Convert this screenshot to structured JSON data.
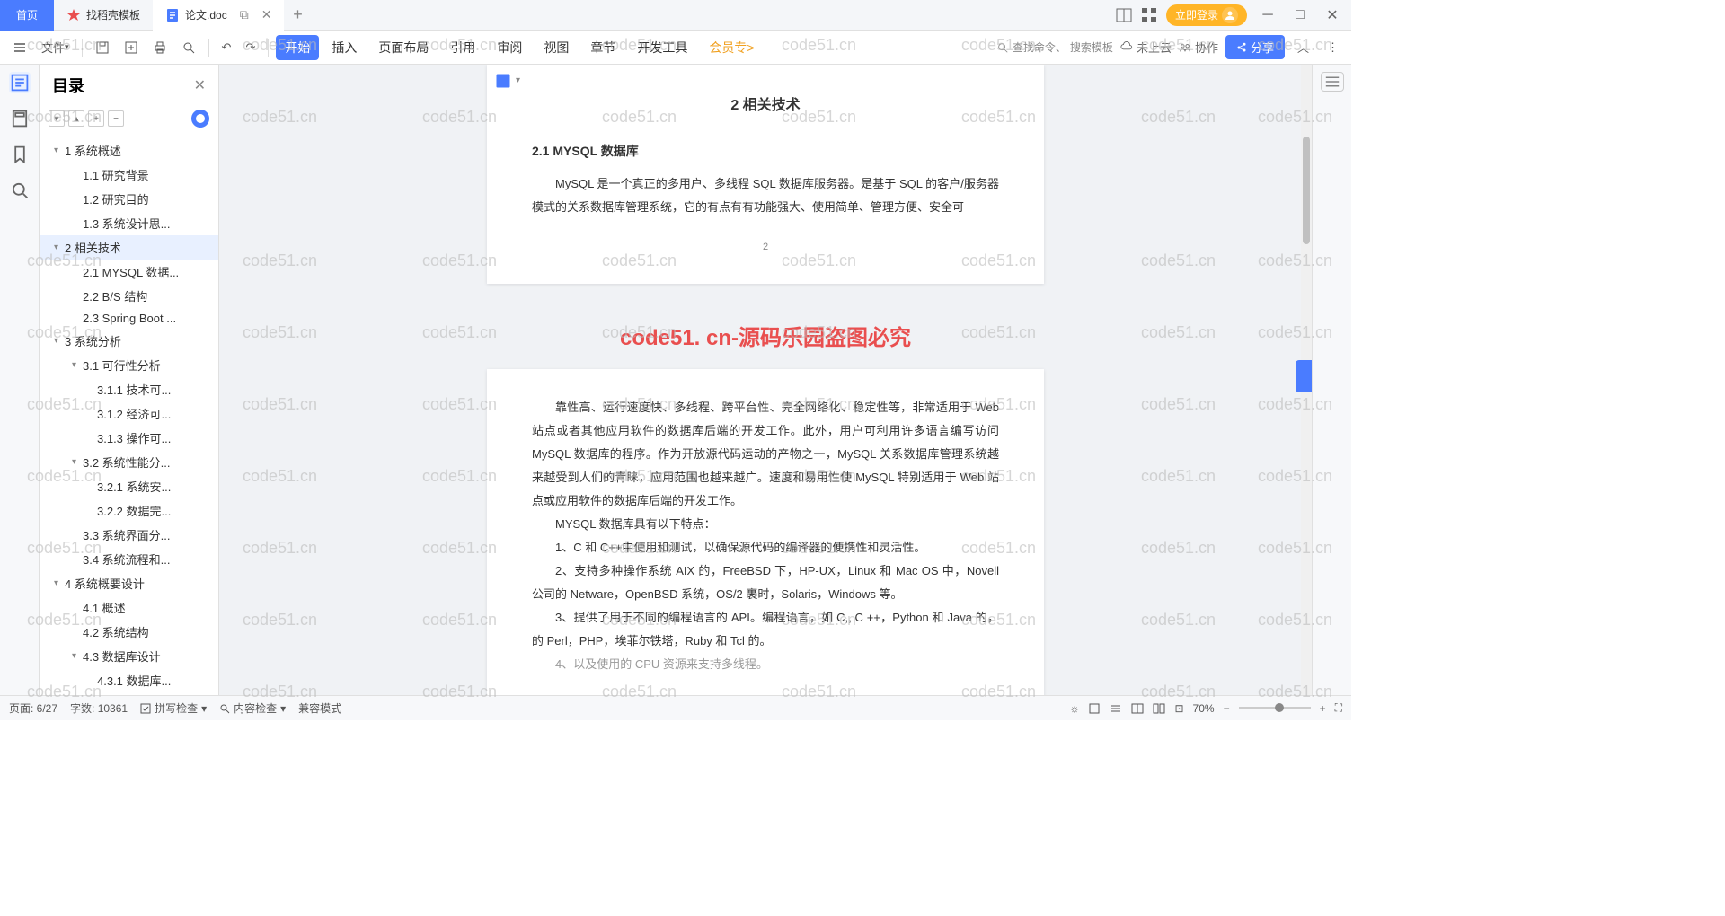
{
  "titlebar": {
    "home": "首页",
    "template": "找稻壳模板",
    "doc": "论文.doc",
    "login": "立即登录"
  },
  "toolbar": {
    "file": "文件"
  },
  "menu": {
    "start": "开始",
    "insert": "插入",
    "layout": "页面布局",
    "reference": "引用",
    "review": "审阅",
    "view": "视图",
    "chapter": "章节",
    "devtools": "开发工具",
    "vip": "会员专"
  },
  "search": {
    "cmd": "查找命令、",
    "tpl": "搜索模板"
  },
  "cloud": {
    "status": "未上云",
    "collab": "协作",
    "share": "分享"
  },
  "outline": {
    "title": "目录",
    "items": [
      {
        "level": 1,
        "text": "1 系统概述",
        "chev": "▾"
      },
      {
        "level": 2,
        "text": "1.1 研究背景"
      },
      {
        "level": 2,
        "text": "1.2 研究目的"
      },
      {
        "level": 2,
        "text": "1.3 系统设计思..."
      },
      {
        "level": 1,
        "text": "2 相关技术",
        "chev": "▾",
        "active": true
      },
      {
        "level": 2,
        "text": "2.1 MYSQL 数据..."
      },
      {
        "level": 2,
        "text": "2.2 B/S 结构"
      },
      {
        "level": 2,
        "text": "2.3 Spring Boot ..."
      },
      {
        "level": 1,
        "text": "3 系统分析",
        "chev": "▾"
      },
      {
        "level": 2,
        "text": "3.1 可行性分析",
        "chev": "▾"
      },
      {
        "level": 3,
        "text": "3.1.1 技术可..."
      },
      {
        "level": 3,
        "text": "3.1.2 经济可..."
      },
      {
        "level": 3,
        "text": "3.1.3 操作可..."
      },
      {
        "level": 2,
        "text": "3.2 系统性能分...",
        "chev": "▾"
      },
      {
        "level": 3,
        "text": "3.2.1 系统安..."
      },
      {
        "level": 3,
        "text": "3.2.2 数据完..."
      },
      {
        "level": 2,
        "text": "3.3 系统界面分..."
      },
      {
        "level": 2,
        "text": "3.4 系统流程和..."
      },
      {
        "level": 1,
        "text": "4 系统概要设计",
        "chev": "▾"
      },
      {
        "level": 2,
        "text": "4.1 概述"
      },
      {
        "level": 2,
        "text": "4.2 系统结构"
      },
      {
        "level": 2,
        "text": "4.3 数据库设计",
        "chev": "▾"
      },
      {
        "level": 3,
        "text": "4.3.1 数据库..."
      }
    ]
  },
  "doc": {
    "h1": "2 相关技术",
    "h2_1": "2.1 MYSQL 数据库",
    "p1": "MySQL 是一个真正的多用户、多线程 SQL 数据库服务器。是基于 SQL 的客户/服务器模式的关系数据库管理系统，它的有点有有功能强大、使用简单、管理方便、安全可",
    "page_num": "2",
    "banner": "code51. cn-源码乐园盗图必究",
    "p2": "靠性高、运行速度快、多线程、跨平台性、完全网络化、稳定性等，非常适用于 Web 站点或者其他应用软件的数据库后端的开发工作。此外，用户可利用许多语言编写访问 MySQL 数据库的程序。作为开放源代码运动的产物之一，MySQL 关系数据库管理系统越来越受到人们的青睐，应用范围也越来越广。速度和易用性使 MySQL 特别适用于 Web 站点或应用软件的数据库后端的开发工作。",
    "p3": "MYSQL 数据库具有以下特点：",
    "p4": "1、C 和 C++中使用和测试，以确保源代码的编译器的便携性和灵活性。",
    "p5": "2、支持多种操作系统 AIX 的，FreeBSD 下，HP-UX，Linux 和 Mac OS 中，Novell 公司的 Netware，OpenBSD 系统，OS/2 裹时，Solaris，Windows 等。",
    "p6": "3、提供了用于不同的编程语言的 API。编程语言，如 C,, C ++，Python 和 Java 的，的 Perl，PHP，埃菲尔铁塔，Ruby 和 Tcl 的。",
    "p7": "4、以及使用的 CPU 资源来支持多线程。"
  },
  "statusbar": {
    "page": "页面: 6/27",
    "words": "字数: 10361",
    "spell": "拼写检查",
    "content": "内容检查",
    "compat": "兼容模式",
    "zoom": "70%"
  },
  "watermark": "code51.cn"
}
